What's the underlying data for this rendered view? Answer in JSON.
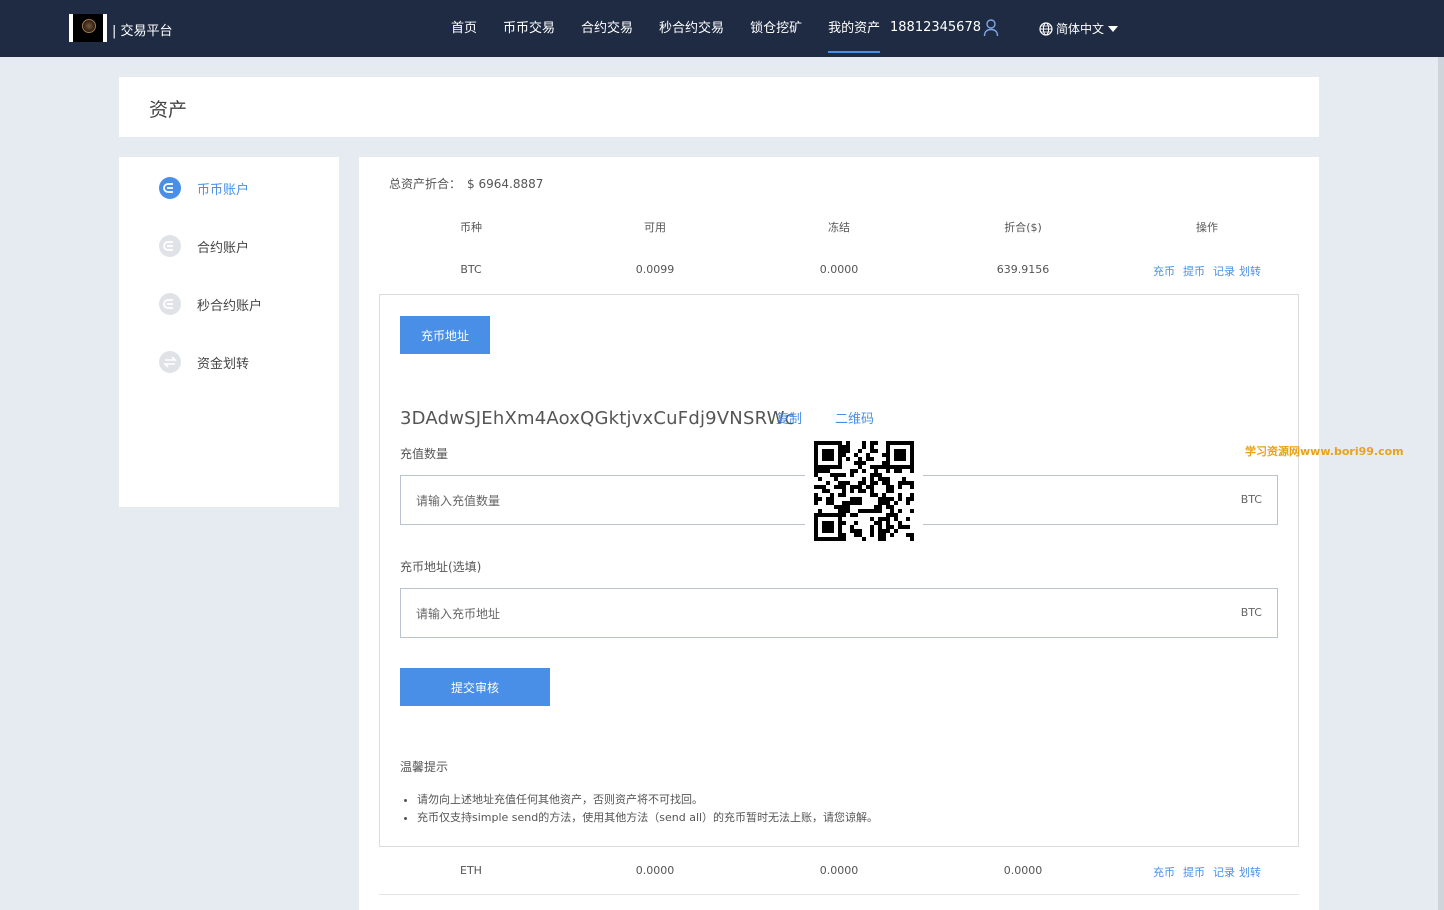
{
  "header": {
    "brand": "| 交易平台",
    "nav": [
      "首页",
      "币币交易",
      "合约交易",
      "秒合约交易",
      "锁仓挖矿",
      "我的资产"
    ],
    "active_nav": "我的资产",
    "phone": "18812345678",
    "language": "简体中文"
  },
  "page": {
    "title": "资产"
  },
  "sidebar": {
    "items": [
      {
        "label": "币币账户",
        "icon": "coin-account-icon"
      },
      {
        "label": "合约账户",
        "icon": "contract-account-icon"
      },
      {
        "label": "秒合约账户",
        "icon": "second-contract-icon"
      },
      {
        "label": "资金划转",
        "icon": "transfer-icon"
      }
    ]
  },
  "main": {
    "total_label": "总资产折合：",
    "total_value": "$ 6964.8887",
    "columns": [
      "币种",
      "可用",
      "冻结",
      "折合($)",
      "操作"
    ],
    "rows": [
      {
        "coin": "BTC",
        "available": "0.0099",
        "frozen": "0.0000",
        "value": "639.9156"
      },
      {
        "coin": "ETH",
        "available": "0.0000",
        "frozen": "0.0000",
        "value": "0.0000"
      }
    ],
    "ops": [
      "充币",
      "提币",
      "记录",
      "划转"
    ]
  },
  "deposit": {
    "tab_label": "充币地址",
    "address": "3DAdwSJEhXm4AoxQGktjvxCuFdj9VNSRWc",
    "copy_label": "复制",
    "qrcode_label": "二维码",
    "amount_label": "充值数量",
    "amount_placeholder": "请输入充值数量",
    "amount_unit": "BTC",
    "addr_label": "充币地址(选填)",
    "addr_placeholder": "请输入充币地址",
    "addr_unit": "BTC",
    "submit_label": "提交审核",
    "tips_title": "温馨提示",
    "tips": [
      "请勿向上述地址充值任何其他资产，否则资产将不可找回。",
      "充币仅支持simple send的方法，使用其他方法（send all）的充币暂时无法上账，请您谅解。"
    ]
  },
  "watermark": "学习资源网www.bori99.com",
  "colors": {
    "nav_bg": "#1e2b43",
    "accent": "#4a8fe7",
    "page_bg": "#e6ebf2",
    "watermark": "#e8a317"
  }
}
